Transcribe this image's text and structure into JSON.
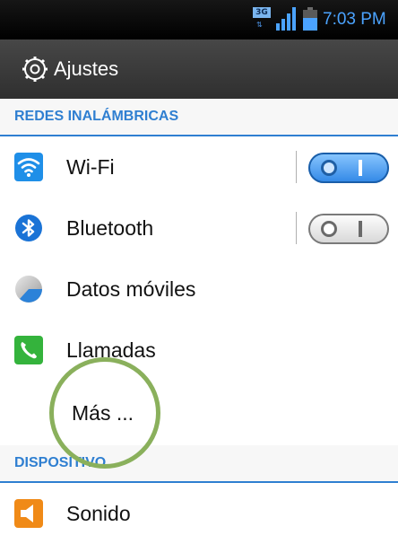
{
  "status_bar": {
    "time": "7:03 PM",
    "network": "3G",
    "icons": [
      "network-type-icon",
      "signal-icon",
      "battery-icon"
    ]
  },
  "header": {
    "title": "Ajustes",
    "icon": "gear-icon"
  },
  "sections": {
    "wireless": "REDES INALÁMBRICAS",
    "device": "DISPOSITIVO"
  },
  "items": {
    "wifi": {
      "label": "Wi-Fi",
      "icon": "wifi-icon",
      "enabled": true
    },
    "bluetooth": {
      "label": "Bluetooth",
      "icon": "bluetooth-icon",
      "enabled": false
    },
    "mobile_data": {
      "label": "Datos móviles",
      "icon": "mobile-data-icon"
    },
    "calls": {
      "label": "Llamadas",
      "icon": "phone-icon"
    },
    "more": {
      "label": "Más ..."
    },
    "sound": {
      "label": "Sonido",
      "icon": "speaker-icon"
    }
  },
  "colors": {
    "accent": "#2f7fd1",
    "status_blue": "#4ba3ff",
    "highlight_circle": "#8ab05c"
  }
}
